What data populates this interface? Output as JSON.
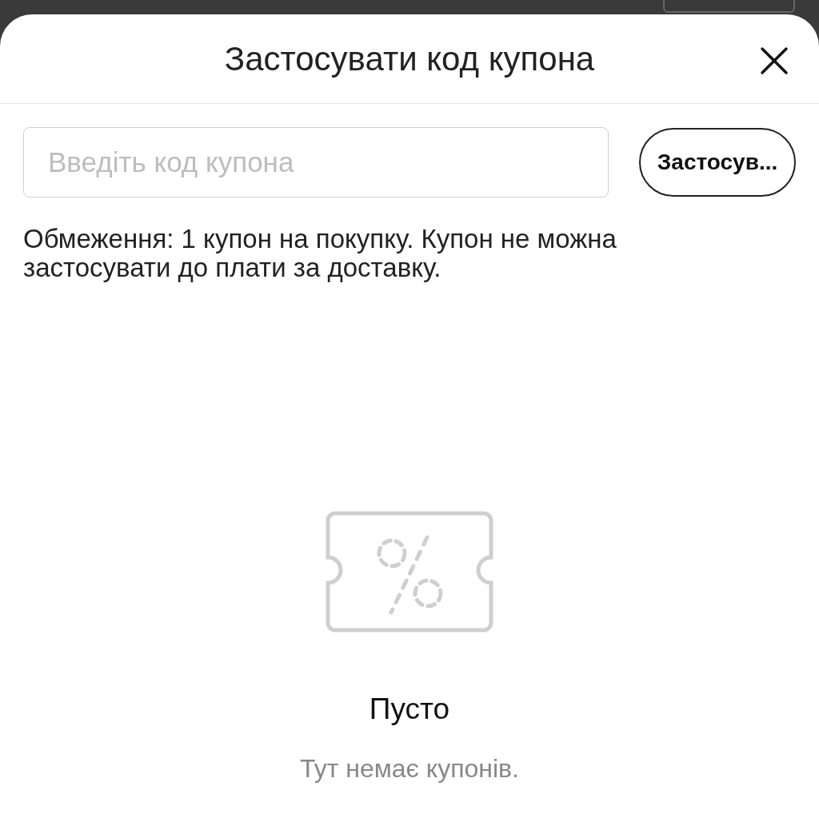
{
  "sheet": {
    "title": "Застосувати код купона"
  },
  "coupon_field": {
    "placeholder": "Введіть код купона"
  },
  "apply_button": {
    "label": "Застосув..."
  },
  "note": "Обмеження: 1 купон на покупку. Купон не можна застосувати до плати за доставку.",
  "empty_state": {
    "title": "Пусто",
    "message": "Тут немає купонів."
  }
}
